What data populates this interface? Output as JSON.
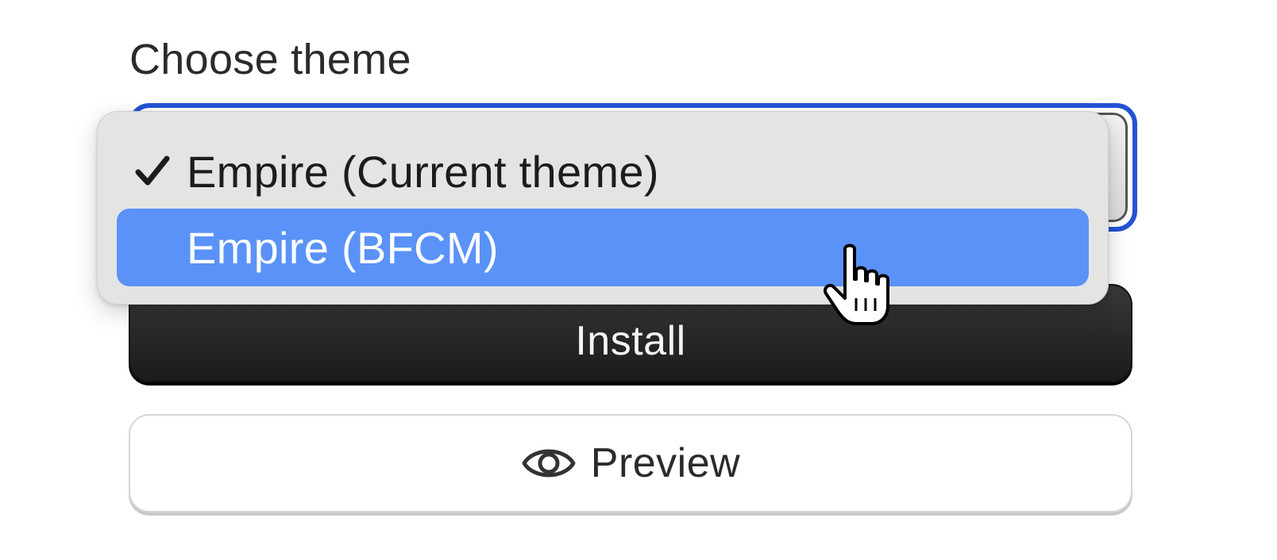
{
  "form": {
    "label": "Choose theme"
  },
  "select": {
    "selected_value": "Empire (Current theme)",
    "focus_color": "#2552d6",
    "options": [
      {
        "label": "Empire (Current theme)",
        "checked": true,
        "highlighted": false
      },
      {
        "label": "Empire (BFCM)",
        "checked": false,
        "highlighted": true
      }
    ],
    "highlight_color": "#5a92f7"
  },
  "actions": {
    "install_label": "Install",
    "preview_label": "Preview",
    "preview_icon": "eye-icon",
    "check_icon": "checkmark-icon",
    "cursor_icon": "hand-pointer-icon"
  }
}
